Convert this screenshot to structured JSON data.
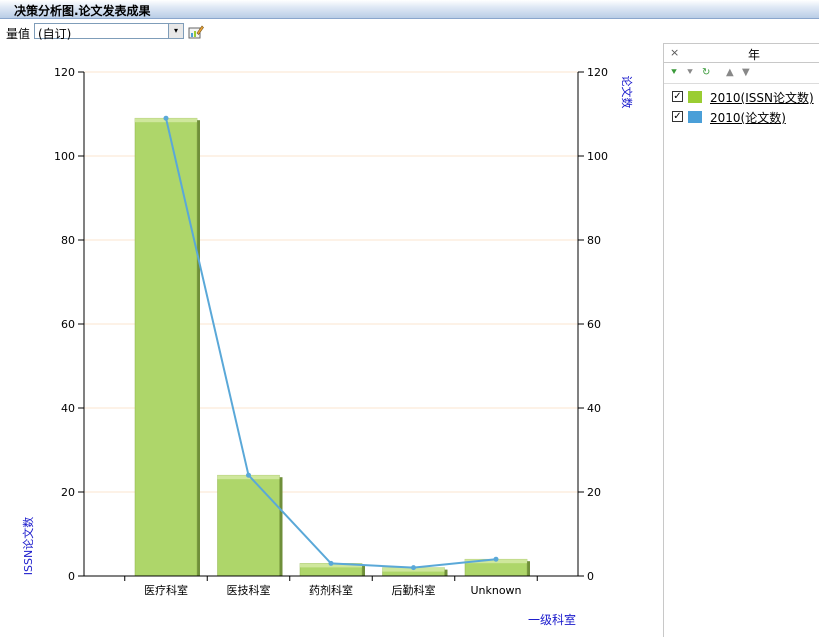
{
  "window": {
    "title": "决策分析图.论文发表成果"
  },
  "toolbar": {
    "measure_label": "量值",
    "measure_value": "(自订)",
    "dropdown_arrow": "▾",
    "edit_icon": "edit-chart-icon"
  },
  "legend": {
    "close": "×",
    "title": "年",
    "tools": [
      "expand-all-icon",
      "collapse-all-icon",
      "refresh-icon",
      "move-up-icon",
      "move-down-icon"
    ],
    "items": [
      {
        "label": "2010(ISSN论文数)",
        "checked": true,
        "color": "#9acd32"
      },
      {
        "label": "2010(论文数)",
        "checked": true,
        "color": "#4a9fd8"
      }
    ]
  },
  "chart_data": {
    "type": "bar",
    "categories": [
      "医疗科室",
      "医技科室",
      "药剂科室",
      "后勤科室",
      "Unknown"
    ],
    "xlabel": "一级科室",
    "ylabel": "ISSN论文数",
    "y2label": "论文数",
    "ylim": [
      0,
      120
    ],
    "y2lim": [
      0,
      120
    ],
    "yticks": [
      "0",
      "20",
      "40",
      "60",
      "80",
      "100",
      "120"
    ],
    "y2ticks": [
      "0",
      "20",
      "40",
      "60",
      "80",
      "100",
      "120"
    ],
    "grid": true,
    "series": [
      {
        "name": "2010(ISSN论文数)",
        "type": "bar",
        "axis": "left",
        "color": "#aed66a",
        "values": [
          109,
          24,
          3,
          2,
          4
        ]
      },
      {
        "name": "2010(论文数)",
        "type": "line",
        "axis": "right",
        "color": "#5aa8d8",
        "values": [
          109,
          24,
          3,
          2,
          4
        ]
      }
    ]
  }
}
